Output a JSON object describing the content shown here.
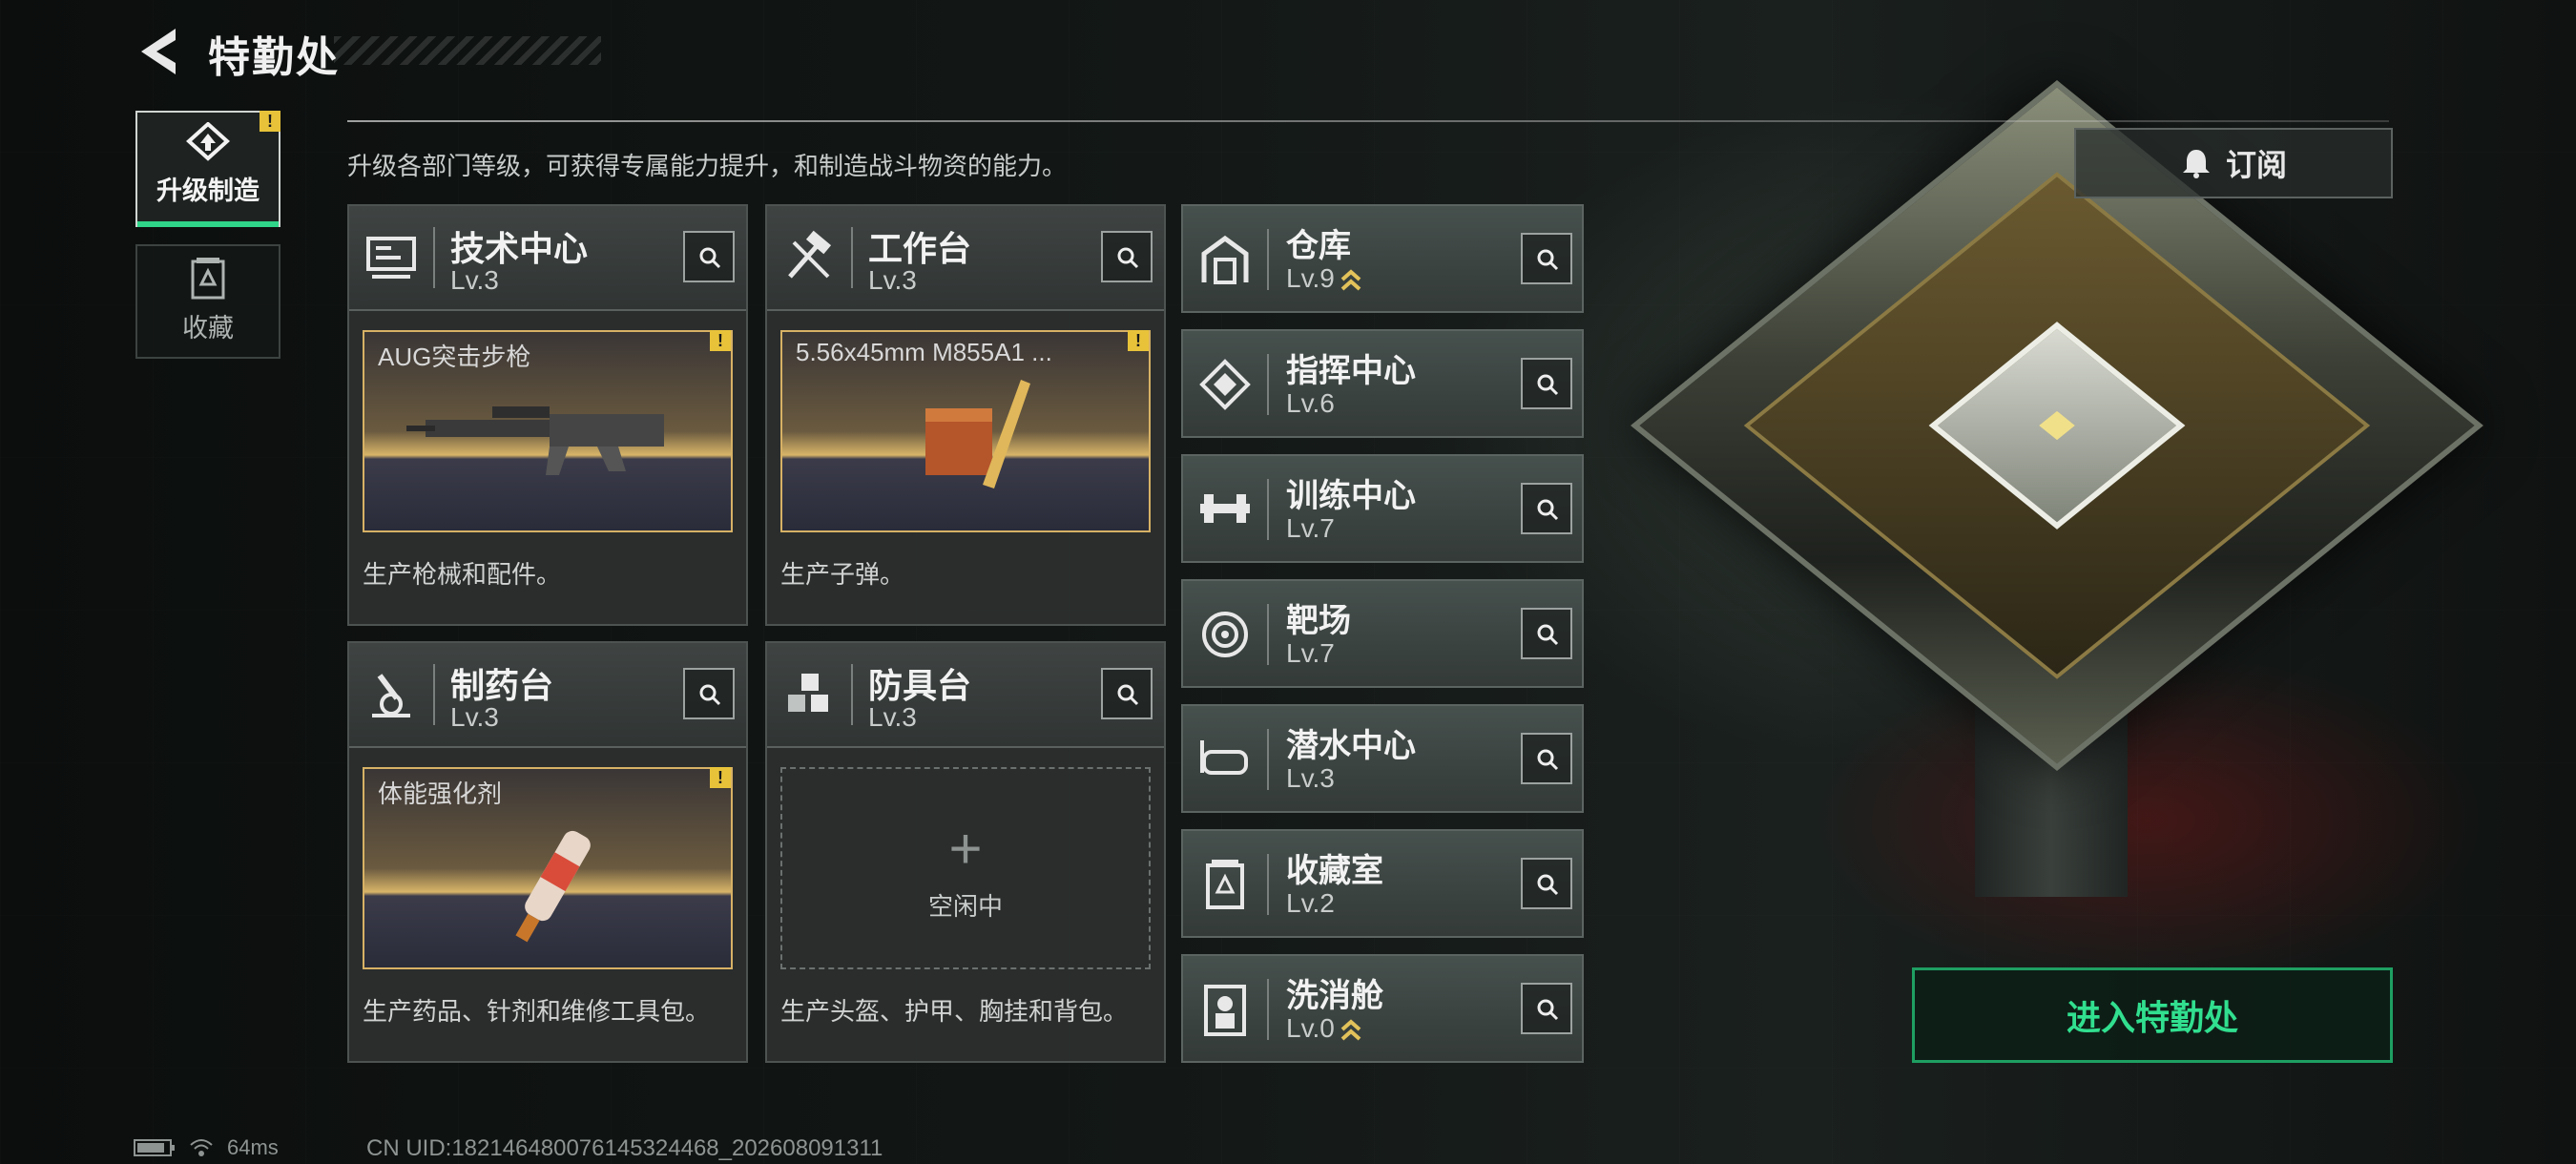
{
  "header": {
    "title": "特勤处",
    "back_icon": "back-arrow-icon"
  },
  "sidebar": {
    "tabs": [
      {
        "label": "升级制造",
        "icon": "upgrade-craft-icon",
        "active": true,
        "alert": "!"
      },
      {
        "label": "收藏",
        "icon": "collection-icon",
        "active": false
      }
    ]
  },
  "description": "升级各部门等级，可获得专属能力提升，和制造战斗物资的能力。",
  "subscribe": {
    "label": "订阅",
    "icon": "bell-icon"
  },
  "workshops": [
    {
      "name": "技术中心",
      "level": "Lv.3",
      "icon": "tech-center-icon",
      "product": "AUG突击步枪",
      "alert": "!",
      "note": "生产枪械和配件。"
    },
    {
      "name": "工作台",
      "level": "Lv.3",
      "icon": "workbench-icon",
      "product": "5.56x45mm M855A1 ...",
      "alert": "!",
      "note": "生产子弹。"
    },
    {
      "name": "制药台",
      "level": "Lv.3",
      "icon": "pharmacy-icon",
      "product": "体能强化剂",
      "alert": "!",
      "note": "生产药品、针剂和维修工具包。"
    },
    {
      "name": "防具台",
      "level": "Lv.3",
      "icon": "armor-bench-icon",
      "idle_label": "空闲中",
      "note": "生产头盔、护甲、胸挂和背包。"
    }
  ],
  "departments": [
    {
      "name": "仓库",
      "level": "Lv.9",
      "icon": "warehouse-icon",
      "upgradable": true
    },
    {
      "name": "指挥中心",
      "level": "Lv.6",
      "icon": "command-center-icon",
      "upgradable": false
    },
    {
      "name": "训练中心",
      "level": "Lv.7",
      "icon": "training-center-icon",
      "upgradable": false
    },
    {
      "name": "靶场",
      "level": "Lv.7",
      "icon": "shooting-range-icon",
      "upgradable": false
    },
    {
      "name": "潜水中心",
      "level": "Lv.3",
      "icon": "diving-center-icon",
      "upgradable": false
    },
    {
      "name": "收藏室",
      "level": "Lv.2",
      "icon": "collection-room-icon",
      "upgradable": false
    },
    {
      "name": "洗消舱",
      "level": "Lv.0",
      "icon": "decon-chamber-icon",
      "upgradable": true
    }
  ],
  "enter_button": "进入特勤处",
  "status": {
    "ping": "64ms",
    "uid": "CN UID:18214648007614532446​8_202608091311"
  },
  "colors": {
    "accent_green": "#2fd588",
    "alert_yellow": "#e8c33a",
    "product_border": "#d7b165",
    "upgrade_arrow": "#e2c25a"
  }
}
